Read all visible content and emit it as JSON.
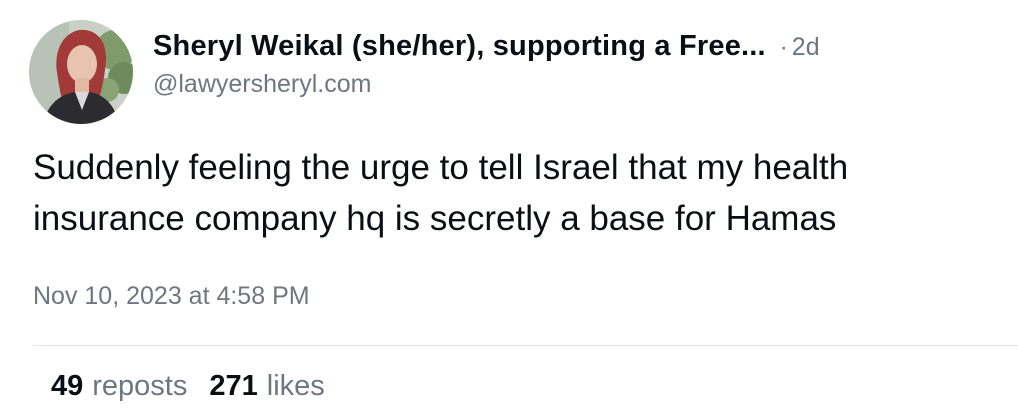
{
  "author": {
    "display_name": "Sheryl Weikal (she/her), supporting a Free...",
    "handle": "@lawyersheryl.com",
    "time_ago": "2d",
    "separator": "·"
  },
  "post": {
    "text_line_1": "Suddenly feeling the urge to tell Israel that my health",
    "text_line_2": "insurance company hq is secretly a base for Hamas",
    "timestamp": "Nov 10, 2023 at 4:58 PM"
  },
  "stats": {
    "reposts_count": "49",
    "reposts_label": "reposts",
    "likes_count": "271",
    "likes_label": "likes"
  },
  "colors": {
    "text": "#0b0f14",
    "muted": "#6e7781",
    "divider": "#e3e6ea"
  }
}
